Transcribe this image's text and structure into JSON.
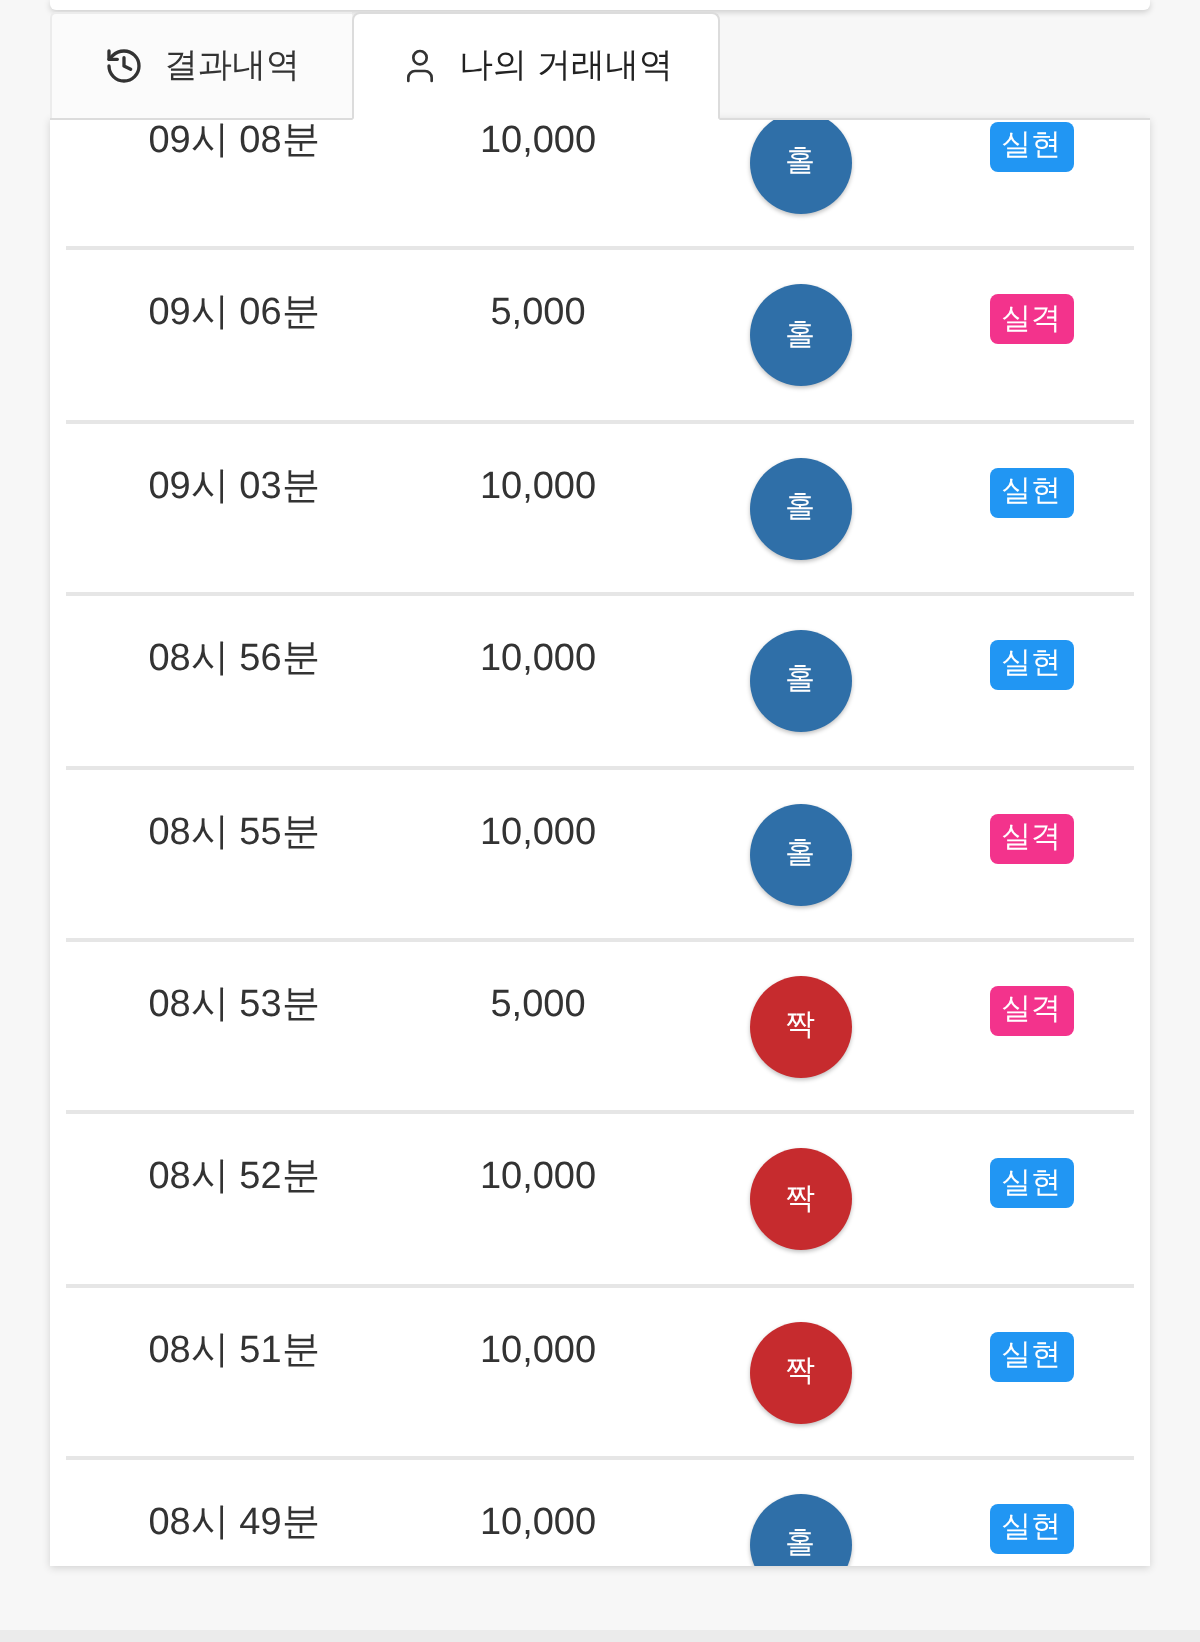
{
  "tabs": [
    {
      "label": "결과내역",
      "selected": false
    },
    {
      "label": "나의 거래내역",
      "selected": true
    }
  ],
  "rows": [
    {
      "time": "09시 08분",
      "amount": "10,000",
      "pick": {
        "label": "홀",
        "color": "#2f6fa8"
      },
      "result": {
        "label": "실현",
        "color": "#2196f3"
      }
    },
    {
      "time": "09시 06분",
      "amount": "5,000",
      "pick": {
        "label": "홀",
        "color": "#2f6fa8"
      },
      "result": {
        "label": "실격",
        "color": "#f3338c"
      }
    },
    {
      "time": "09시 03분",
      "amount": "10,000",
      "pick": {
        "label": "홀",
        "color": "#2f6fa8"
      },
      "result": {
        "label": "실현",
        "color": "#2196f3"
      }
    },
    {
      "time": "08시 56분",
      "amount": "10,000",
      "pick": {
        "label": "홀",
        "color": "#2f6fa8"
      },
      "result": {
        "label": "실현",
        "color": "#2196f3"
      }
    },
    {
      "time": "08시 55분",
      "amount": "10,000",
      "pick": {
        "label": "홀",
        "color": "#2f6fa8"
      },
      "result": {
        "label": "실격",
        "color": "#f3338c"
      }
    },
    {
      "time": "08시 53분",
      "amount": "5,000",
      "pick": {
        "label": "짝",
        "color": "#c62b2e"
      },
      "result": {
        "label": "실격",
        "color": "#f3338c"
      }
    },
    {
      "time": "08시 52분",
      "amount": "10,000",
      "pick": {
        "label": "짝",
        "color": "#c62b2e"
      },
      "result": {
        "label": "실현",
        "color": "#2196f3"
      }
    },
    {
      "time": "08시 51분",
      "amount": "10,000",
      "pick": {
        "label": "짝",
        "color": "#c62b2e"
      },
      "result": {
        "label": "실현",
        "color": "#2196f3"
      }
    },
    {
      "time": "08시 49분",
      "amount": "10,000",
      "pick": {
        "label": "홀",
        "color": "#2f6fa8"
      },
      "result": {
        "label": "실현",
        "color": "#2196f3"
      }
    }
  ]
}
